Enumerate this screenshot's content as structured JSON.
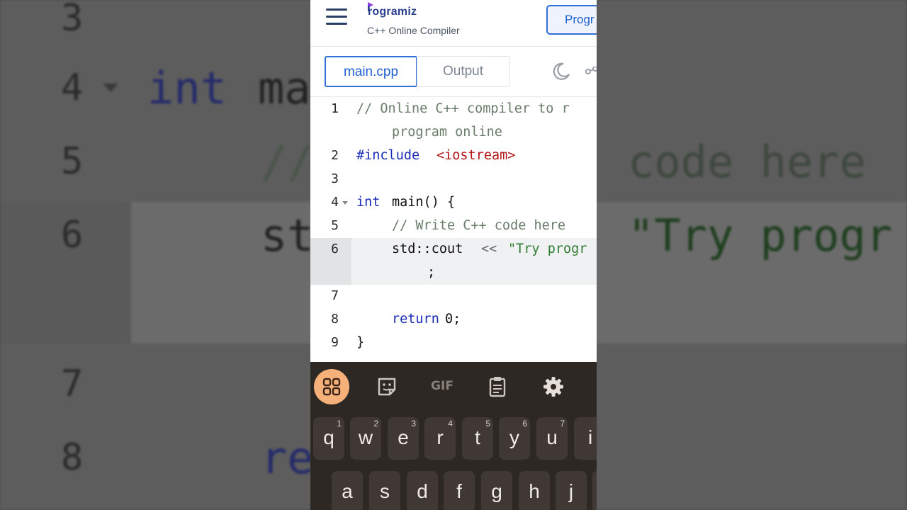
{
  "background": {
    "line_numbers": [
      "3",
      "4",
      "5",
      "6",
      "7",
      "8"
    ],
    "code_int": "int",
    "code_main_partial": "ma",
    "code_comment_partial": "//",
    "code_here": "code here",
    "code_std_partial": "st",
    "code_string_partial": "\"Try progr",
    "code_return_partial": "re"
  },
  "header": {
    "logo_text": "rogramiz",
    "subtitle": "C++ Online Compiler",
    "pro_button_label": "Progr"
  },
  "tabs": [
    {
      "label": "main.cpp",
      "active": true
    },
    {
      "label": "Output",
      "active": false
    }
  ],
  "editor": {
    "line_numbers": [
      "1",
      "2",
      "3",
      "4",
      "5",
      "6",
      "7",
      "8",
      "9"
    ],
    "active_line": "6",
    "line1_a": "// Online C++ compiler to r",
    "line1_b": "program online",
    "line2_kw": "#include",
    "line2_lib": "<iostream>",
    "line4_kw": "int",
    "line4_rest": "main() {",
    "line5": "// Write C++ code here",
    "line6_fn": "std::cout",
    "line6_op": "<<",
    "line6_str": "\"Try progr",
    "line6_cont": ";",
    "line8_kw": "return",
    "line8_rest": "0;",
    "line9": "}"
  },
  "keyboard": {
    "toolbar": [
      {
        "name": "apps-grid-icon"
      },
      {
        "name": "sticker-icon"
      },
      {
        "name": "gif-button",
        "label": "GIF"
      },
      {
        "name": "clipboard-icon"
      },
      {
        "name": "settings-gear-icon"
      }
    ],
    "row1": [
      {
        "key": "q",
        "sup": "1"
      },
      {
        "key": "w",
        "sup": "2"
      },
      {
        "key": "e",
        "sup": "3"
      },
      {
        "key": "r",
        "sup": "4"
      },
      {
        "key": "t",
        "sup": "5"
      },
      {
        "key": "y",
        "sup": "6"
      },
      {
        "key": "u",
        "sup": "7"
      },
      {
        "key": "i",
        "sup": ""
      }
    ],
    "row2": [
      {
        "key": "a"
      },
      {
        "key": "s"
      },
      {
        "key": "d"
      },
      {
        "key": "f"
      },
      {
        "key": "g"
      },
      {
        "key": "h"
      },
      {
        "key": "j"
      }
    ]
  },
  "colors": {
    "brand_blue": "#2f6fd6",
    "keyword": "#1a2cb8",
    "include_string": "#b01414",
    "comment": "#6a7d6a",
    "keyboard_bg": "#2e2825",
    "keyboard_accent": "#f6b07a"
  }
}
